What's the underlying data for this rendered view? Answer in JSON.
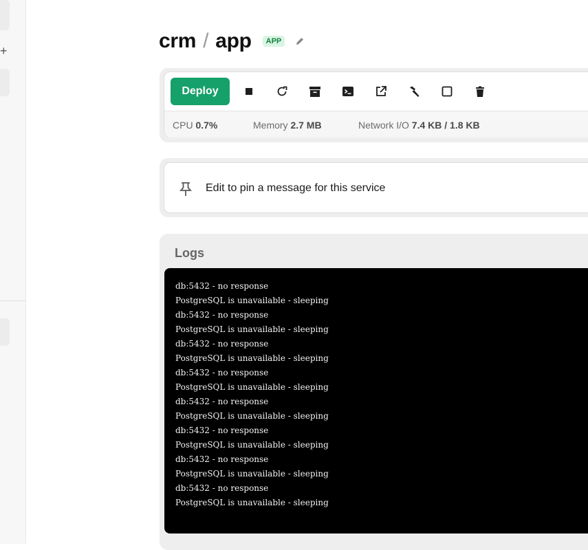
{
  "header": {
    "project": "crm",
    "separator": "/",
    "service": "app",
    "badge": "APP"
  },
  "toolbar": {
    "deploy_label": "Deploy",
    "icons": [
      "stop-icon",
      "restart-icon",
      "archive-icon",
      "terminal-icon",
      "external-link-icon",
      "build-icon",
      "square-icon",
      "delete-icon"
    ]
  },
  "stats": {
    "cpu_label": "CPU",
    "cpu_value": "0.7%",
    "memory_label": "Memory",
    "memory_value": "2.7 MB",
    "network_label": "Network I/O",
    "network_value": "7.4 KB / 1.8 KB"
  },
  "pin": {
    "message": "Edit to pin a message for this service"
  },
  "logs": {
    "title": "Logs",
    "lines": [
      "db:5432 - no response",
      "PostgreSQL is unavailable - sleeping",
      "db:5432 - no response",
      "PostgreSQL is unavailable - sleeping",
      "db:5432 - no response",
      "PostgreSQL is unavailable - sleeping",
      "db:5432 - no response",
      "PostgreSQL is unavailable - sleeping",
      "db:5432 - no response",
      "PostgreSQL is unavailable - sleeping",
      "db:5432 - no response",
      "PostgreSQL is unavailable - sleeping",
      "db:5432 - no response",
      "PostgreSQL is unavailable - sleeping",
      "db:5432 - no response",
      "PostgreSQL is unavailable - sleeping"
    ]
  },
  "colors": {
    "accent": "#16a06a",
    "badge_bg": "#d9f5e4",
    "badge_fg": "#15803d",
    "terminal_bg": "#000000"
  }
}
